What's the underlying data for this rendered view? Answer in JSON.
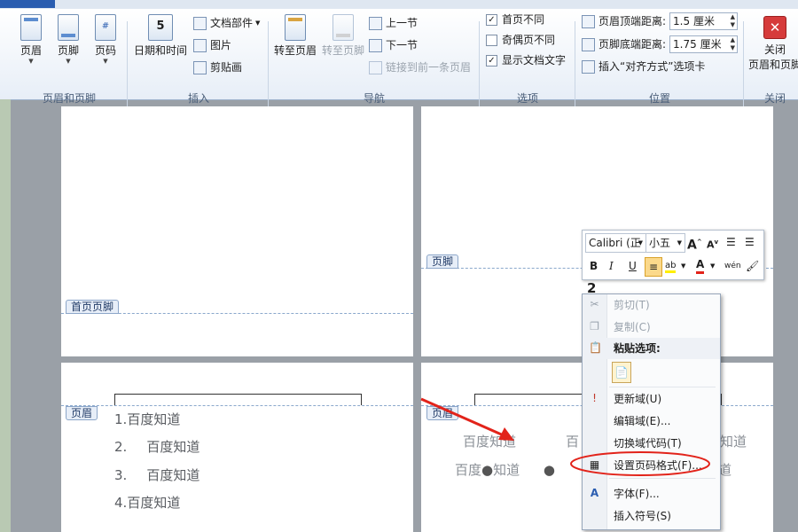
{
  "ribbon": {
    "groups": {
      "hf": {
        "label": "页眉和页脚",
        "buttons": [
          "页眉",
          "页脚",
          "页码"
        ]
      },
      "insert": {
        "label": "插入",
        "datetime": "日期和时间",
        "items": [
          "文档部件",
          "图片",
          "剪贴画"
        ]
      },
      "nav": {
        "label": "导航",
        "goto_header": "转至页眉",
        "goto_footer": "转至页脚",
        "prev": "上一节",
        "next": "下一节",
        "link_prev": "链接到前一条页眉"
      },
      "options": {
        "label": "选项",
        "items": [
          {
            "label": "首页不同",
            "checked": "✓"
          },
          {
            "label": "奇偶页不同",
            "checked": ""
          },
          {
            "label": "显示文档文字",
            "checked": "✓"
          }
        ]
      },
      "position": {
        "label": "位置",
        "header_dist_label": "页眉顶端距离:",
        "header_dist_value": "1.5 厘米",
        "footer_dist_label": "页脚底端距离:",
        "footer_dist_value": "1.75 厘米",
        "insert_align_tab": "插入“对齐方式”选项卡"
      },
      "close": {
        "label": "关闭",
        "button_line1": "关闭",
        "button_line2": "页眉和页脚"
      }
    }
  },
  "pages": {
    "top_left": {
      "footer_label": "首页页脚"
    },
    "top_right": {
      "footer_label": "页脚"
    },
    "bottom_left": {
      "header_label": "页眉",
      "list": [
        {
          "num": "1.",
          "text": "百度知道"
        },
        {
          "num": "2.",
          "text": "百度知道"
        },
        {
          "num": "3.",
          "text": "百度知道"
        },
        {
          "num": "4.",
          "text": "百度知道"
        }
      ]
    },
    "bottom_right": {
      "header_label": "页眉",
      "line1": [
        "百度知道",
        "百",
        "知道"
      ],
      "line2": [
        "百度",
        "知道",
        "道"
      ]
    }
  },
  "mini_toolbar": {
    "font": "Calibri (正",
    "size": "小五",
    "bold": "B",
    "italic": "I",
    "underline": "U",
    "grow": "A",
    "shrink": "A",
    "font_color_letter": "A",
    "phonetic": "wén"
  },
  "context_menu": {
    "items": [
      {
        "label": "剪切(T)",
        "enabled": false,
        "icon": "scissors-icon"
      },
      {
        "label": "复制(C)",
        "enabled": false,
        "icon": "copy-icon"
      },
      {
        "label": "粘贴选项:",
        "enabled": true,
        "icon": "paste-icon"
      },
      {
        "label": "更新域(U)",
        "enabled": true,
        "icon": "update-field-icon"
      },
      {
        "label": "编辑域(E)...",
        "enabled": true,
        "icon": ""
      },
      {
        "label": "切换域代码(T)",
        "enabled": true,
        "icon": ""
      },
      {
        "label": "设置页码格式(F)...",
        "enabled": true,
        "icon": "page-number-format-icon"
      },
      {
        "label": "字体(F)...",
        "enabled": true,
        "icon": "font-icon"
      },
      {
        "label": "插入符号(S)",
        "enabled": true,
        "icon": ""
      }
    ]
  },
  "colors": {
    "annotation_red": "#e2231a",
    "file_tab_blue": "#2a5db0",
    "close_red": "#d63b3b"
  }
}
